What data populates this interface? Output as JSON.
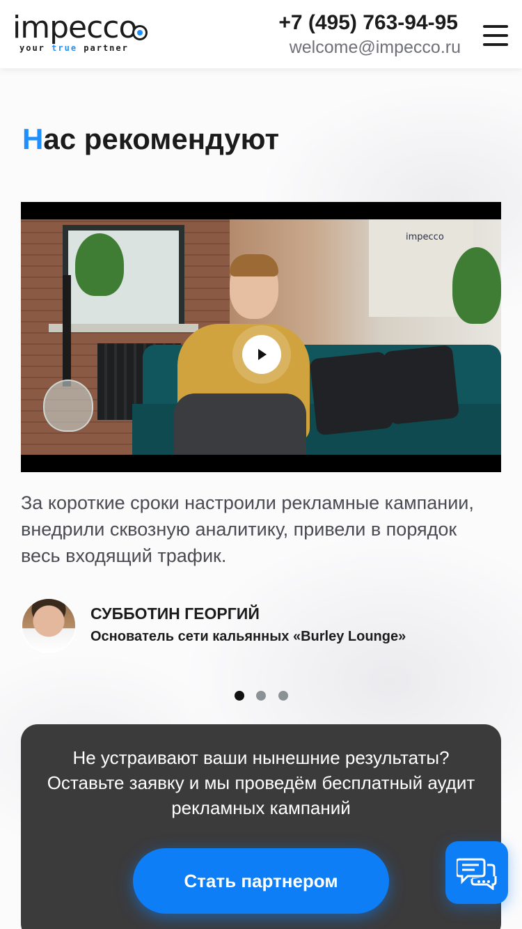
{
  "header": {
    "logo_main": "impecco",
    "logo_tag_left": "your",
    "logo_tag_mid": "true",
    "logo_tag_right": "partner",
    "phone": "+7 (495) 763-94-95",
    "email": "welcome@impecco.ru",
    "menu_icon": "hamburger-menu-icon"
  },
  "section": {
    "title_first_letter": "Н",
    "title_rest": "ас рекомендуют"
  },
  "video": {
    "overlay_logo": "impecco",
    "play_icon": "play-icon"
  },
  "review": {
    "text": "За короткие сроки настроили рекламные кампании, внедрили сквозную аналитику, привели в порядок весь входящий трафик.",
    "author_name": "СУББОТИН ГЕОРГИЙ",
    "author_role": "Основатель сети кальянных «Burley Lounge»"
  },
  "slider": {
    "dots": [
      {
        "active": true
      },
      {
        "active": false
      },
      {
        "active": false
      }
    ]
  },
  "cta": {
    "text": "Не устраивают ваши нынешние результаты? Оставьте заявку и мы проведём бесплатный аудит рекламных кампаний",
    "button_label": "Стать партнером"
  },
  "chat": {
    "icon": "chat-bubbles-icon"
  },
  "colors": {
    "accent": "#1e8fff",
    "button": "#0d7ef5",
    "cta_bg": "#3b3b3c"
  }
}
